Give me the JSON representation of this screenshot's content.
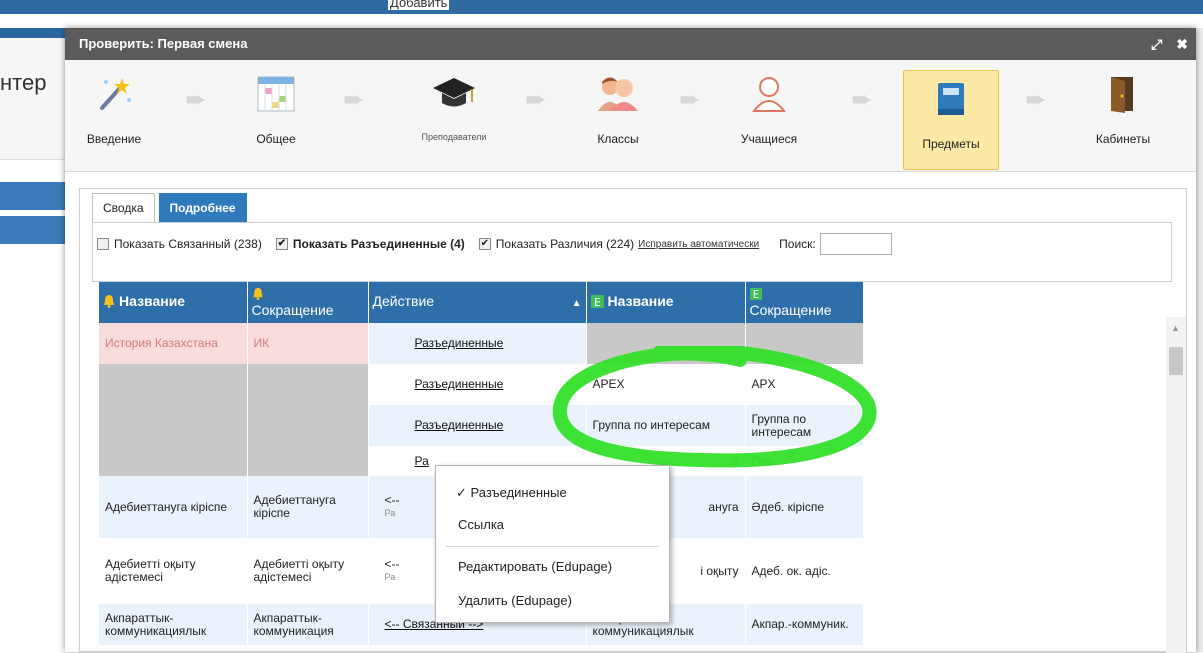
{
  "background": {
    "top_caption": "Добавить",
    "truncated_text": "нтер"
  },
  "dialog": {
    "title": "Проверить: Первая смена",
    "controls": {
      "maximize": "⤢",
      "close": "✖"
    }
  },
  "wizard": {
    "steps": [
      {
        "label": "Введение",
        "icon": "magic-wand-icon"
      },
      {
        "label": "Общее",
        "icon": "timetable-grid-icon"
      },
      {
        "label": "Преподаватели",
        "icon": "graduation-cap-icon"
      },
      {
        "label": "Классы",
        "icon": "students-group-icon"
      },
      {
        "label": "Учащиеся",
        "icon": "student-icon"
      },
      {
        "label": "Предметы",
        "icon": "book-icon",
        "active": true
      },
      {
        "label": "Кабинеты",
        "icon": "door-icon"
      }
    ]
  },
  "tabs": [
    {
      "label": "Сводка"
    },
    {
      "label": "Подробнее",
      "active": true
    }
  ],
  "options": {
    "show_linked": {
      "label": "Показать Связанный (238)",
      "checked": false
    },
    "show_unlinked": {
      "label": "Показать Разъединенные (4)",
      "checked": true
    },
    "show_diff": {
      "label": "Показать Различия (224)",
      "checked": true
    },
    "fix_auto": "Исправить автоматически",
    "search_label": "Поиск:",
    "search_value": ""
  },
  "table": {
    "headers": {
      "name_left": "Название",
      "abbr_left": "Сокращение",
      "action": "Действие",
      "name_right": "Название",
      "abbr_right": "Сокращение"
    },
    "rows": [
      {
        "name_left": "История Казахстана",
        "abbr_left": "ИК",
        "action": "Разъединенные",
        "name_right": "",
        "abbr_right": ""
      },
      {
        "name_left": "",
        "abbr_left": "",
        "action": "Разъединенные",
        "name_right": "APEX",
        "abbr_right": "APX"
      },
      {
        "name_left": "",
        "abbr_left": "",
        "action": "Разъединенные",
        "name_right": "Группа по интересам",
        "abbr_right": "Группа по интересам"
      },
      {
        "name_left": "",
        "abbr_left": "",
        "action": "Ра",
        "name_right": "е",
        "abbr_right": "Пов"
      },
      {
        "name_left": "Адебиеттануга кiрiспе",
        "abbr_left": "Адебиеттануга кiрiспе",
        "action": "<--",
        "action_sub": "Ра",
        "name_right": "ануга",
        "abbr_right": "Әдеб. кiрiспе"
      },
      {
        "name_left": "Адебиеттi оқыту адiстемесi",
        "abbr_left": "Адебиеттi оқыту адiстемесi",
        "action": "<--",
        "action_sub": "Ра",
        "name_right": "i оқыту",
        "abbr_right": "Адеб. ок. адiс."
      },
      {
        "name_left": "Акпараттык-коммуникациялык",
        "abbr_left": "Акпараттык-коммуникация",
        "action": "<-- Связанный -->",
        "name_right": "Акпараттык-коммуникациялык",
        "abbr_right": "Акпар.-коммуник."
      }
    ]
  },
  "context_menu": {
    "items": [
      "✓ Разъединенные",
      "Ссылка",
      "Редактировать (Edupage)",
      "Удалить (Edupage)"
    ]
  },
  "colors": {
    "title_bar": "#5b5b5b",
    "header_blue": "#2f6fa9",
    "active_step": "#fde9a6",
    "highlight_green": "#33e02a"
  }
}
